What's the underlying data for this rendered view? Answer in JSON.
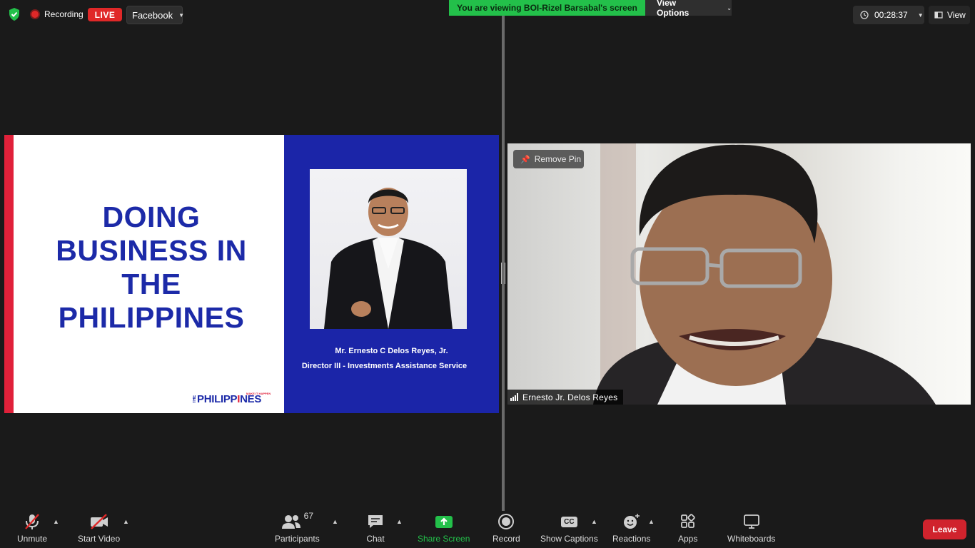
{
  "topbar": {
    "recording_label": "Recording",
    "live_label": "LIVE",
    "stream_target": "Facebook",
    "viewing_banner": "You are viewing BOI-Rizel Barsabal's screen",
    "view_options_label": "View Options",
    "timer": "00:28:37",
    "view_label": "View"
  },
  "slide": {
    "title": "DOING BUSINESS IN THE PHILIPPINES",
    "speaker_name": "Mr. Ernesto C Delos Reyes, Jr.",
    "speaker_title": "Director III - Investments Assistance Service",
    "logo_main": "PHILIPP",
    "logo_accent": "I",
    "logo_end": "NES",
    "logo_prefix": "THE",
    "logo_tagline": "MAKE IT HAPPEN"
  },
  "video": {
    "remove_pin_label": "Remove Pin",
    "participant_name": "Ernesto Jr. Delos Reyes"
  },
  "toolbar": {
    "unmute": "Unmute",
    "start_video": "Start Video",
    "participants": "Participants",
    "participants_count": "67",
    "chat": "Chat",
    "share_screen": "Share Screen",
    "record": "Record",
    "show_captions": "Show Captions",
    "captions_icon_text": "CC",
    "reactions": "Reactions",
    "apps": "Apps",
    "whiteboards": "Whiteboards",
    "leave": "Leave"
  },
  "colors": {
    "accent_green": "#23c04a",
    "live_red": "#e02828",
    "slide_blue": "#1b25a8",
    "slide_red": "#e0213a",
    "leave_red": "#d0232d"
  }
}
